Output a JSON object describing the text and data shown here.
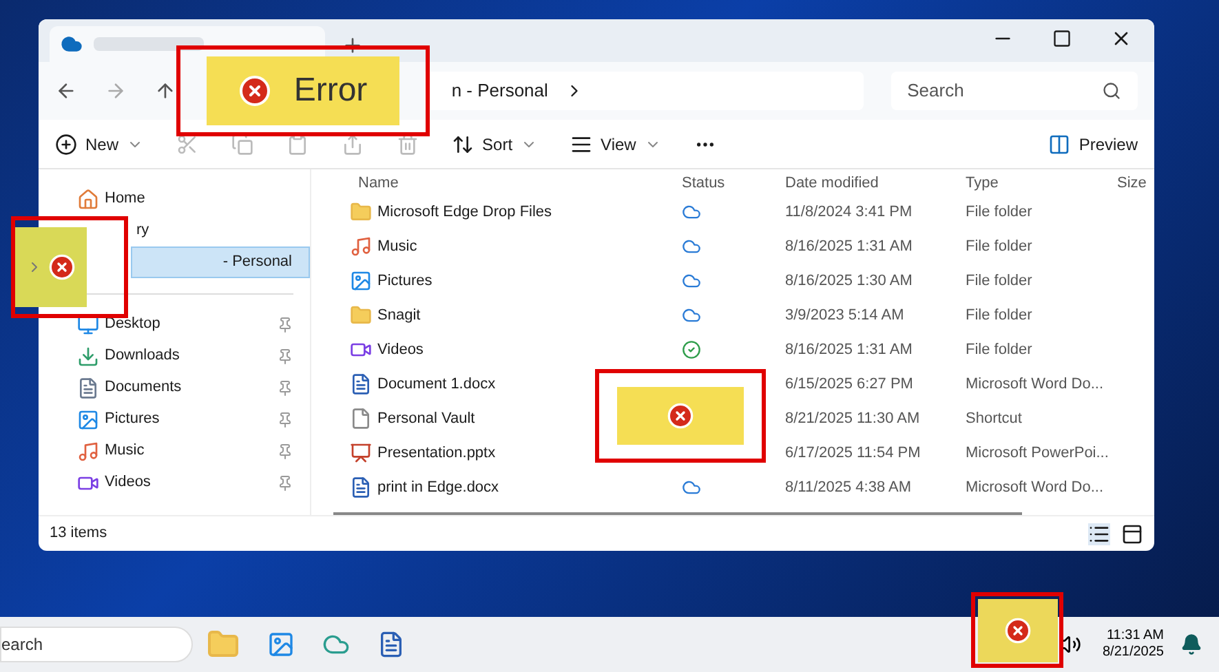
{
  "address": {
    "path": "n - Personal"
  },
  "search": {
    "placeholder": "Search"
  },
  "toolbar": {
    "new": "New",
    "sort": "Sort",
    "view": "View",
    "preview": "Preview"
  },
  "sidebar": {
    "items": [
      {
        "label": "Home",
        "kind": "home",
        "pinned": false,
        "selected": false
      },
      {
        "label": "ry",
        "kind": "plain",
        "pinned": false,
        "selected": false
      },
      {
        "label": "- Personal",
        "kind": "plain",
        "pinned": false,
        "selected": true
      },
      {
        "label": "Desktop",
        "kind": "desktop",
        "pinned": true,
        "selected": false
      },
      {
        "label": "Downloads",
        "kind": "download",
        "pinned": true,
        "selected": false
      },
      {
        "label": "Documents",
        "kind": "documents",
        "pinned": true,
        "selected": false
      },
      {
        "label": "Pictures",
        "kind": "pictures",
        "pinned": true,
        "selected": false
      },
      {
        "label": "Music",
        "kind": "music",
        "pinned": true,
        "selected": false
      },
      {
        "label": "Videos",
        "kind": "videos",
        "pinned": true,
        "selected": false
      }
    ]
  },
  "table": {
    "columns": [
      "Name",
      "Status",
      "Date modified",
      "Type",
      "Size"
    ],
    "rows": [
      {
        "name": "Microsoft Edge Drop Files",
        "kind": "folder",
        "online_only": true,
        "synced": false,
        "date": "11/8/2024 3:41 PM",
        "type": "File folder"
      },
      {
        "name": "Music",
        "kind": "music",
        "online_only": true,
        "synced": false,
        "date": "8/16/2025 1:31 AM",
        "type": "File folder"
      },
      {
        "name": "Pictures",
        "kind": "pictures",
        "online_only": true,
        "synced": false,
        "date": "8/16/2025 1:30 AM",
        "type": "File folder"
      },
      {
        "name": "Snagit",
        "kind": "folder",
        "online_only": true,
        "synced": false,
        "date": "3/9/2023 5:14 AM",
        "type": "File folder"
      },
      {
        "name": "Videos",
        "kind": "videos",
        "online_only": false,
        "synced": true,
        "date": "8/16/2025 1:31 AM",
        "type": "File folder"
      },
      {
        "name": "Document 1.docx",
        "kind": "word",
        "online_only": false,
        "synced": false,
        "date": "6/15/2025 6:27 PM",
        "type": "Microsoft Word Do..."
      },
      {
        "name": "Personal Vault",
        "kind": "shortcut",
        "online_only": false,
        "synced": false,
        "date": "8/21/2025 11:30 AM",
        "type": "Shortcut"
      },
      {
        "name": "Presentation.pptx",
        "kind": "powerpoint",
        "online_only": false,
        "synced": false,
        "date": "6/17/2025 11:54 PM",
        "type": "Microsoft PowerPoi..."
      },
      {
        "name": "print in Edge.docx",
        "kind": "word",
        "online_only": true,
        "synced": false,
        "date": "8/11/2025 4:38 AM",
        "type": "Microsoft Word Do..."
      }
    ]
  },
  "status_bar": {
    "count": "13 items"
  },
  "callouts": {
    "error_label": "Error"
  },
  "taskbar": {
    "search_placeholder": "earch",
    "time": "11:31 AM",
    "date": "8/21/2025"
  }
}
